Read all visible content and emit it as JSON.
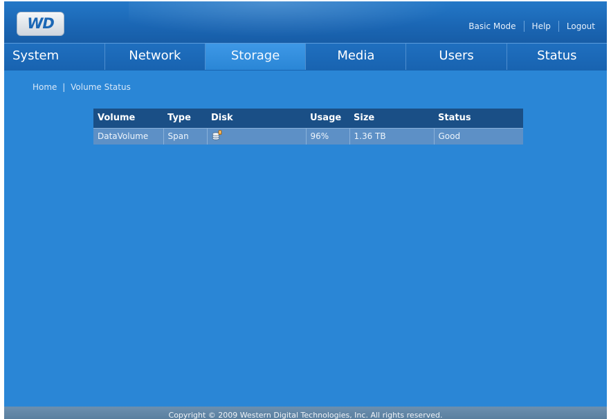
{
  "header": {
    "logo_text": "WD",
    "links": {
      "basic_mode": "Basic Mode",
      "help": "Help",
      "logout": "Logout"
    }
  },
  "nav": {
    "tabs": [
      {
        "label": "System"
      },
      {
        "label": "Network"
      },
      {
        "label": "Storage",
        "active": true
      },
      {
        "label": "Media"
      },
      {
        "label": "Users"
      },
      {
        "label": "Status"
      }
    ]
  },
  "breadcrumb": {
    "home": "Home",
    "separator": "|",
    "current": "Volume Status"
  },
  "volume_table": {
    "columns": [
      "Volume",
      "Type",
      "Disk",
      "Usage",
      "Size",
      "Status"
    ],
    "rows": [
      {
        "volume": "DataVolume",
        "type": "Span",
        "disk_icon": "disk-stack-warning-icon",
        "usage": "96%",
        "size": "1.36 TB",
        "status": "Good"
      }
    ]
  },
  "footer": {
    "copyright": "Copyright © 2009 Western Digital Technologies, Inc. All rights reserved."
  },
  "colors": {
    "background": "#2a86d6",
    "header": "#1b67b5",
    "table_header": "#1a4f86",
    "table_row": "#5d90c6"
  }
}
